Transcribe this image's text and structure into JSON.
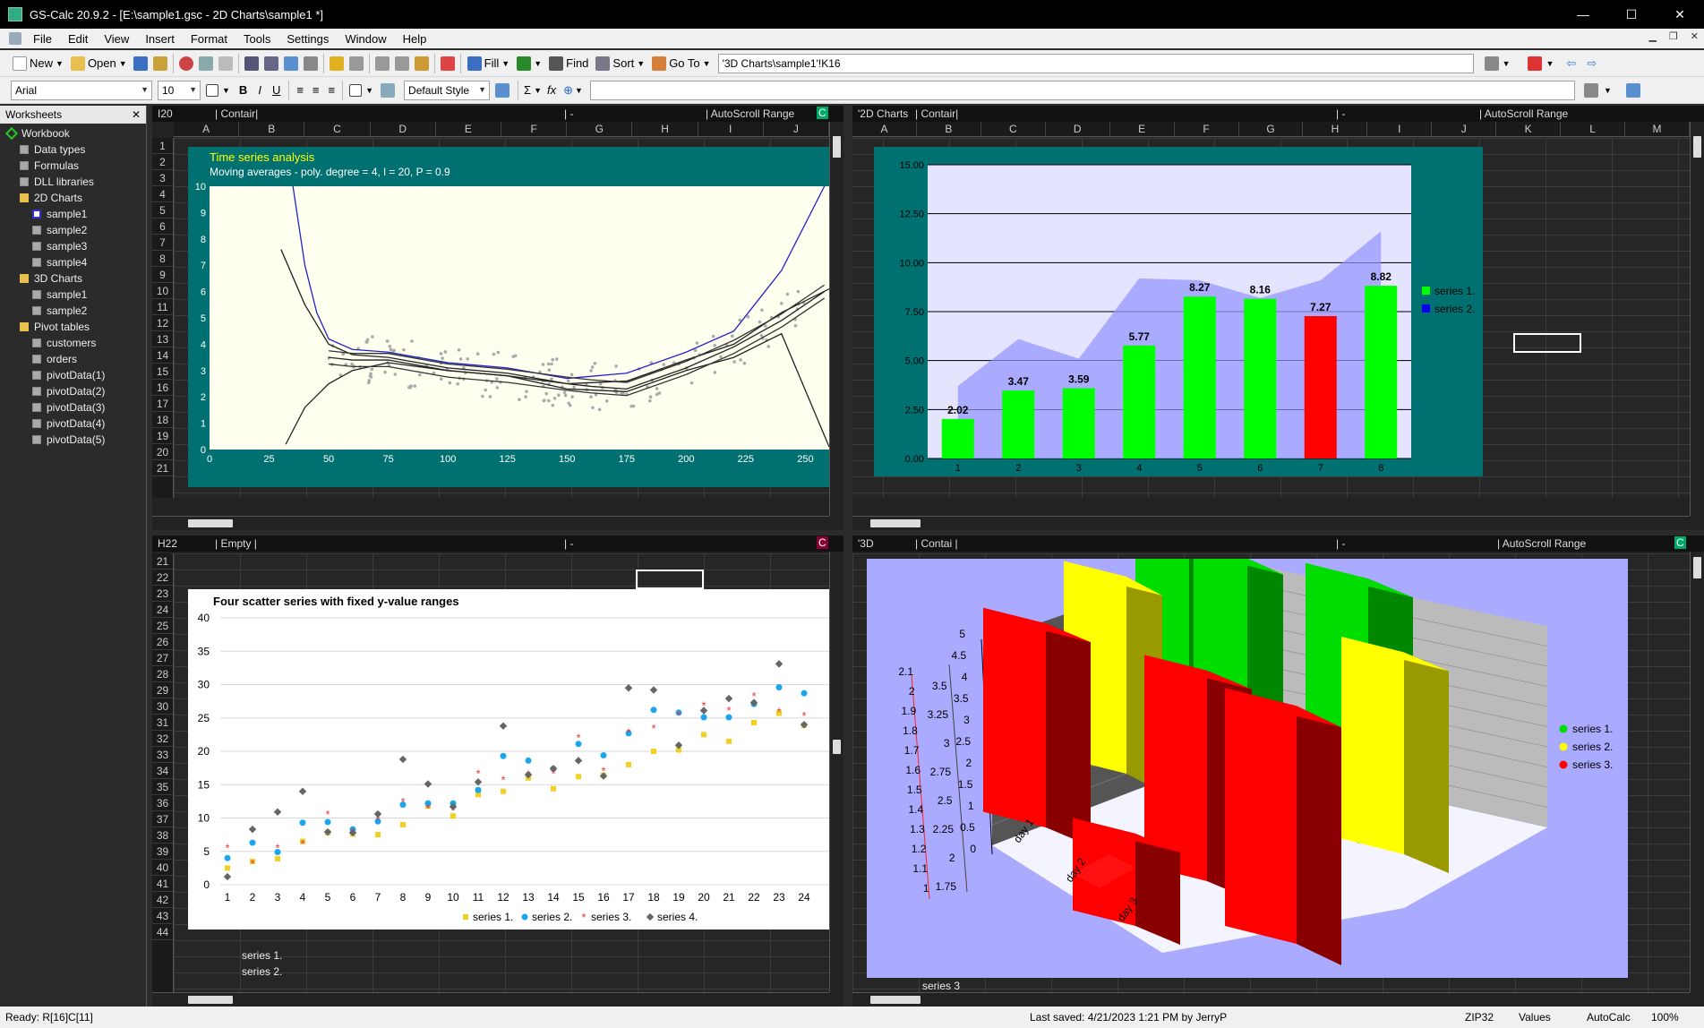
{
  "window": {
    "title": "GS-Calc 20.9.2 - [E:\\sample1.gsc - 2D Charts\\sample1 *]",
    "min": "—",
    "max": "☐",
    "close": "✕"
  },
  "menu": [
    "File",
    "Edit",
    "View",
    "Insert",
    "Format",
    "Tools",
    "Settings",
    "Window",
    "Help"
  ],
  "toolbar": {
    "new": "New",
    "open": "Open",
    "fill": "Fill",
    "find": "Find",
    "sort": "Sort",
    "goto": "Go To",
    "address": "'3D Charts\\sample1'!K16"
  },
  "format_bar": {
    "font": "Arial",
    "size": "10",
    "style": "Default Style",
    "bold": "B",
    "italic": "I",
    "underline": "U",
    "sigma": "Σ",
    "fx": "fx"
  },
  "sidebar": {
    "header": "Worksheets",
    "nodes": [
      {
        "label": "Workbook",
        "level": 0
      },
      {
        "label": "Data types",
        "level": 1
      },
      {
        "label": "Formulas",
        "level": 1
      },
      {
        "label": "DLL libraries",
        "level": 1
      },
      {
        "label": "2D Charts",
        "level": 1
      },
      {
        "label": "sample1",
        "level": 2
      },
      {
        "label": "sample2",
        "level": 2
      },
      {
        "label": "sample3",
        "level": 2
      },
      {
        "label": "sample4",
        "level": 2
      },
      {
        "label": "3D Charts",
        "level": 1
      },
      {
        "label": "sample1",
        "level": 2
      },
      {
        "label": "sample2",
        "level": 2
      },
      {
        "label": "Pivot tables",
        "level": 1
      },
      {
        "label": "customers",
        "level": 2
      },
      {
        "label": "orders",
        "level": 2
      },
      {
        "label": "pivotData(1)",
        "level": 2
      },
      {
        "label": "pivotData(2)",
        "level": 2
      },
      {
        "label": "pivotData(3)",
        "level": 2
      },
      {
        "label": "pivotData(4)",
        "level": 2
      },
      {
        "label": "pivotData(5)",
        "level": 2
      }
    ]
  },
  "panes": {
    "tl": {
      "cell": "I20",
      "type": "| Contair|",
      "dash": "| -",
      "scroll": "| AutoScroll Range",
      "badge": "C",
      "cols": [
        "A",
        "B",
        "C",
        "D",
        "E",
        "F",
        "G",
        "H",
        "I",
        "J"
      ],
      "rows": [
        "1",
        "2",
        "3",
        "4",
        "5",
        "6",
        "7",
        "8",
        "9",
        "10",
        "11",
        "12",
        "13",
        "14",
        "15",
        "16",
        "17",
        "18",
        "19",
        "20",
        "21"
      ]
    },
    "tr": {
      "cell": "'2D Charts",
      "type": "| Contair|",
      "dash": "| -",
      "scroll": "| AutoScroll Range",
      "cols": [
        "A",
        "B",
        "C",
        "D",
        "E",
        "F",
        "G",
        "H",
        "I",
        "J",
        "K",
        "L",
        "M"
      ]
    },
    "bl": {
      "cell": "H22",
      "type": "| Empty |",
      "dash": "| -",
      "badge": "C",
      "rows": [
        "21",
        "22",
        "23",
        "24",
        "25",
        "26",
        "27",
        "28",
        "29",
        "30",
        "31",
        "32",
        "33",
        "34",
        "35",
        "36",
        "37",
        "38",
        "39",
        "40",
        "41",
        "42",
        "43",
        "44"
      ],
      "cell_text": [
        "series 1.",
        "series 2.",
        "series 3"
      ]
    },
    "br": {
      "cell": "'3D",
      "type": "| Contai |",
      "dash": "| -",
      "scroll": "| AutoScroll Range",
      "badge": "C",
      "cell_text": "series 3"
    }
  },
  "chart_data": [
    {
      "type": "scatter",
      "title": "Time series analysis",
      "subtitle": "Moving averages - poly. degree = 4, l = 20, P = 0.9",
      "xlim": [
        0,
        260
      ],
      "ylim": [
        0,
        10
      ],
      "xticks": [
        "0",
        "25",
        "50",
        "75",
        "100",
        "125",
        "150",
        "175",
        "200",
        "225",
        "250"
      ],
      "yticks": [
        "0",
        "1",
        "2",
        "3",
        "4",
        "5",
        "6",
        "7",
        "8",
        "9",
        "10"
      ],
      "trend": {
        "x": [
          30,
          40,
          50,
          60,
          75,
          100,
          125,
          150,
          175,
          200,
          220,
          240,
          260
        ],
        "y": [
          7.6,
          5.5,
          4.0,
          3.6,
          3.5,
          3.1,
          2.9,
          2.5,
          2.6,
          3.4,
          4.0,
          5.2,
          6.1
        ]
      },
      "upper": {
        "x": [
          35,
          40,
          45,
          50,
          60,
          75,
          100,
          125,
          150,
          175,
          200,
          220,
          240,
          258
        ],
        "y": [
          10,
          7.0,
          5.2,
          4.2,
          3.8,
          3.7,
          3.3,
          3.1,
          2.7,
          2.9,
          3.7,
          4.5,
          6.8,
          10
        ]
      },
      "lower": {
        "x": [
          32,
          40,
          50,
          60,
          75,
          100,
          125,
          150,
          175,
          200,
          220,
          240,
          260
        ],
        "y": [
          0.2,
          1.6,
          2.5,
          3.0,
          3.3,
          3.0,
          2.8,
          2.3,
          2.2,
          3.0,
          3.5,
          4.4,
          0.1
        ]
      },
      "ma": {
        "x": [
          50,
          60,
          75,
          100,
          125,
          150,
          160,
          175,
          200,
          220,
          240,
          258
        ],
        "y": [
          3.5,
          3.4,
          3.4,
          3.0,
          2.8,
          2.5,
          2.4,
          2.3,
          3.1,
          3.9,
          4.9,
          6.0
        ]
      }
    },
    {
      "type": "bar",
      "categories": [
        "1",
        "2",
        "3",
        "4",
        "5",
        "6",
        "7",
        "8"
      ],
      "series": [
        {
          "name": "series 1.",
          "values": [
            2.02,
            3.47,
            3.59,
            5.77,
            8.27,
            8.16,
            7.27,
            8.82
          ]
        },
        {
          "name": "series 2.",
          "values": [
            3.7,
            6.1,
            5.1,
            9.2,
            9.1,
            8.2,
            9.1,
            11.6
          ]
        }
      ],
      "labels": [
        "2.02",
        "3.47",
        "3.59",
        "5.77",
        "8.27",
        "8.16",
        "7.27",
        "8.82"
      ],
      "ylim": [
        0,
        15
      ],
      "yticks": [
        "0.00",
        "2.50",
        "5.00",
        "7.50",
        "10.00",
        "12.50",
        "15.00"
      ],
      "colors": {
        "bar": "#00ff00",
        "highlight": "#ff0000",
        "area": "#aaaaff",
        "legend2": "#0000ee"
      }
    },
    {
      "type": "scatter",
      "title": "Four scatter series with fixed y-value ranges",
      "categories": [
        "1",
        "2",
        "3",
        "4",
        "5",
        "6",
        "7",
        "8",
        "9",
        "10",
        "11",
        "12",
        "13",
        "14",
        "15",
        "16",
        "17",
        "18",
        "19",
        "20",
        "21",
        "22",
        "23",
        "24"
      ],
      "ylim": [
        0,
        40
      ],
      "yticks": [
        "0",
        "5",
        "10",
        "15",
        "20",
        "25",
        "30",
        "35",
        "40"
      ],
      "series": [
        {
          "name": "series 1.",
          "values": [
            2.5,
            3.5,
            3.9,
            6.5,
            7.8,
            7.6,
            7.5,
            9.0,
            11.8,
            10.3,
            13.5,
            14.0,
            16.0,
            14.4,
            16.2,
            16.4,
            18.0,
            20.0,
            20.2,
            22.5,
            21.5,
            24.3,
            25.7,
            23.9
          ]
        },
        {
          "name": "series 2.",
          "values": [
            4.0,
            6.3,
            4.9,
            9.3,
            9.4,
            8.3,
            9.5,
            12.0,
            12.2,
            12.2,
            14.2,
            19.3,
            18.6,
            17.4,
            21.1,
            19.4,
            22.7,
            26.2,
            25.8,
            25.1,
            25.1,
            27.1,
            29.6,
            28.7
          ]
        },
        {
          "name": "series 3.",
          "values": [
            5.6,
            3.2,
            5.6,
            6.2,
            10.6,
            8.0,
            9.8,
            12.5,
            11.5,
            11.2,
            16.7,
            15.8,
            16.6,
            16.7,
            22.1,
            17.1,
            22.9,
            23.5,
            25.5,
            26.9,
            26.2,
            28.3,
            26.0,
            25.4
          ]
        },
        {
          "name": "series 4.",
          "values": [
            1.2,
            8.3,
            10.9,
            14.0,
            7.9,
            7.8,
            10.6,
            18.8,
            15.1,
            11.7,
            15.4,
            23.8,
            16.5,
            17.4,
            18.6,
            16.3,
            29.5,
            29.2,
            20.9,
            26.1,
            27.9,
            27.3,
            33.1,
            24.0
          ]
        }
      ],
      "colors": {
        "s1": "#f0d020",
        "s2": "#1aa6ee",
        "s3": "#ee3333",
        "s4": "#666666"
      }
    },
    {
      "type": "bar",
      "categories": [
        "day 1",
        "day 2",
        "day 3"
      ],
      "series": [
        {
          "name": "series 1.",
          "values": [
            4.3,
            4.5,
            4.6
          ]
        },
        {
          "name": "series 2.",
          "values": [
            4.0,
            2.0,
            4.1
          ]
        },
        {
          "name": "series 3.",
          "values": [
            4.5,
            2.5,
            4.6
          ]
        }
      ],
      "axis_right": [
        "1.75",
        "2",
        "2.25",
        "2.5",
        "2.75",
        "3",
        "3.25",
        "3.5"
      ],
      "axis_left": [
        "1",
        "1.1",
        "1.2",
        "1.3",
        "1.4",
        "1.5",
        "1.6",
        "1.7",
        "1.8",
        "1.9",
        "2",
        "2.1"
      ],
      "axis_z": [
        "0",
        "0.5",
        "1",
        "1.5",
        "2",
        "2.5",
        "3",
        "3.5",
        "4",
        "4.5",
        "5"
      ],
      "colors": {
        "s1": "#00dd00",
        "s2": "#ffff00",
        "s3": "#ff0000",
        "bg": "#aaaaff"
      }
    }
  ],
  "status": {
    "ready": "Ready:  R[16]C[11]",
    "saved": "Last saved:  4/21/2023 1:21 PM  by  JerryP",
    "zip": "ZIP32",
    "mode": "Values",
    "calc": "AutoCalc",
    "zoom": "100%"
  }
}
